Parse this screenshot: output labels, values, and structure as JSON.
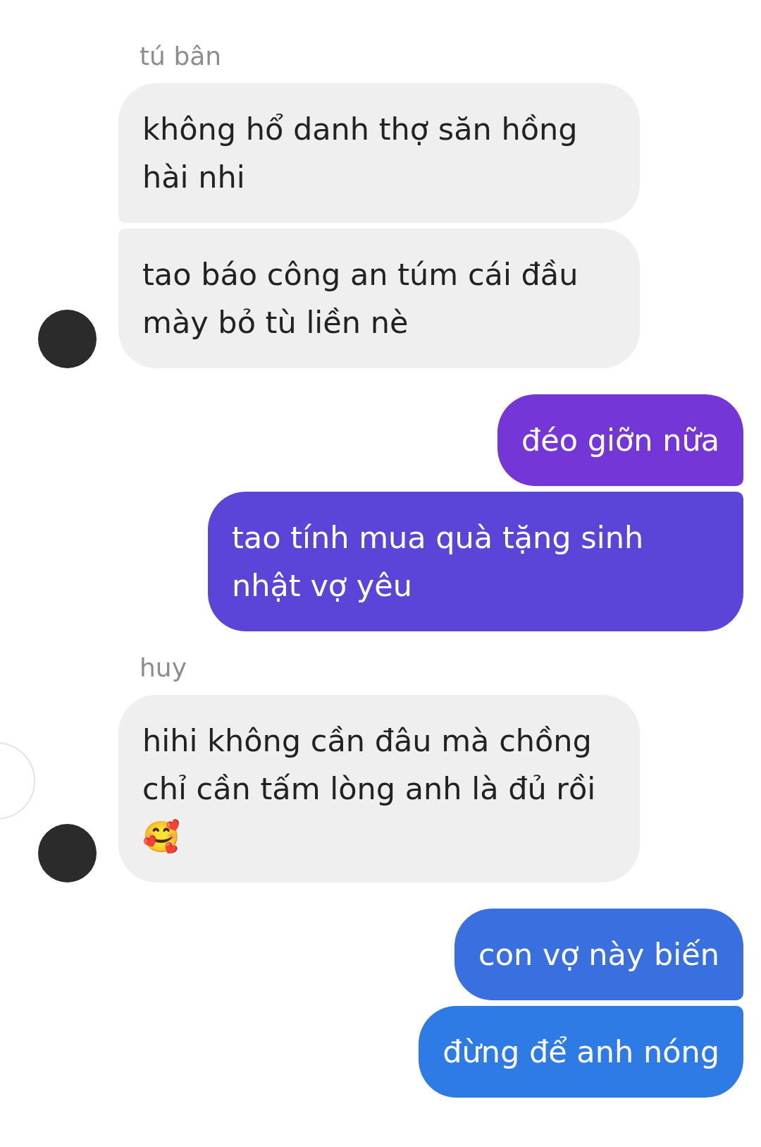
{
  "groups": [
    {
      "kind": "incoming",
      "sender": "tú bân",
      "messages": [
        {
          "text": "không hổ danh thợ săn hồng hài nhi"
        },
        {
          "text": "tao báo công an túm cái đầu mày bỏ tù liền nè"
        }
      ]
    },
    {
      "kind": "outgoing",
      "messages": [
        {
          "text": "đéo giỡn nữa",
          "color": "#7436d6"
        },
        {
          "text": "tao tính mua quà tặng sinh nhật vợ yêu",
          "color": "#5a45d8"
        }
      ]
    },
    {
      "kind": "incoming",
      "sender": "huy",
      "messages": [
        {
          "text": "hihi không cần đâu mà chồng chỉ cần tấm lòng anh là đủ rồi 🥰"
        }
      ]
    },
    {
      "kind": "outgoing",
      "messages": [
        {
          "text": "con vợ này biến",
          "color": "#3a6fe0"
        },
        {
          "text": "đừng để anh nóng",
          "color": "#2f7be6"
        }
      ]
    }
  ]
}
